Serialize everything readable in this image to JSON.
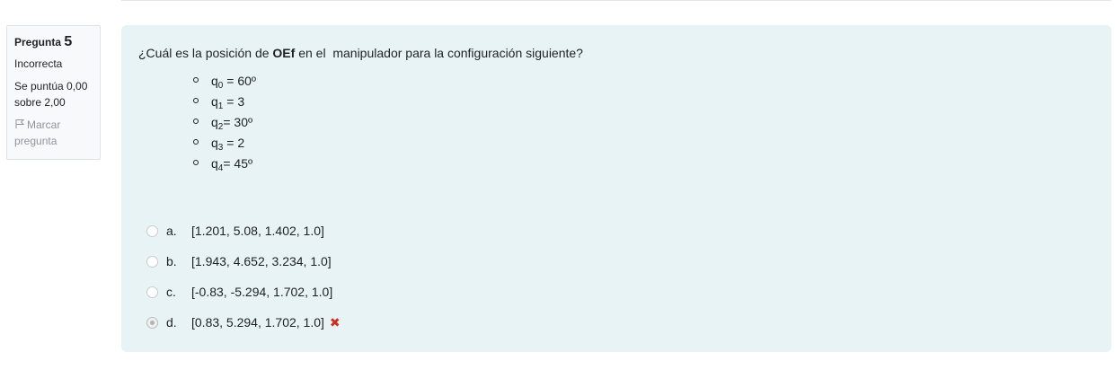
{
  "info": {
    "question_word": "Pregunta",
    "question_number": "5",
    "state": "Incorrecta",
    "grade_line1": "Se puntúa 0,00",
    "grade_line2": "sobre 2,00",
    "flag_line1": "Marcar",
    "flag_line2": "pregunta"
  },
  "question": {
    "text_before": "¿Cuál es la posición de ",
    "text_bold": "OEf",
    "text_after": " en el  manipulador para la configuración siguiente?",
    "params": [
      {
        "var": "q",
        "sub": "0",
        "value": " = 60º"
      },
      {
        "var": "q",
        "sub": "1",
        "value": " = 3"
      },
      {
        "var": "q",
        "sub": "2",
        "value": "= 30º"
      },
      {
        "var": "q",
        "sub": "3",
        "value": " = 2"
      },
      {
        "var": "q",
        "sub": "4",
        "value": "= 45º"
      }
    ]
  },
  "answers": [
    {
      "letter": "a.",
      "text": "[1.201, 5.08, 1.402, 1.0]",
      "selected": false
    },
    {
      "letter": "b.",
      "text": "[1.943, 4.652, 3.234, 1.0]",
      "selected": false
    },
    {
      "letter": "c.",
      "text": "[-0.83, -5.294, 1.702, 1.0]",
      "selected": false
    },
    {
      "letter": "d.",
      "text": "[0.83, 5.294, 1.702, 1.0]",
      "selected": true,
      "mark": "✖"
    }
  ],
  "colors": {
    "panel": "#e7f3f5",
    "wrong": "#ca3120"
  },
  "icons": {
    "flag": "flag-icon",
    "incorrect": "cross-icon"
  }
}
